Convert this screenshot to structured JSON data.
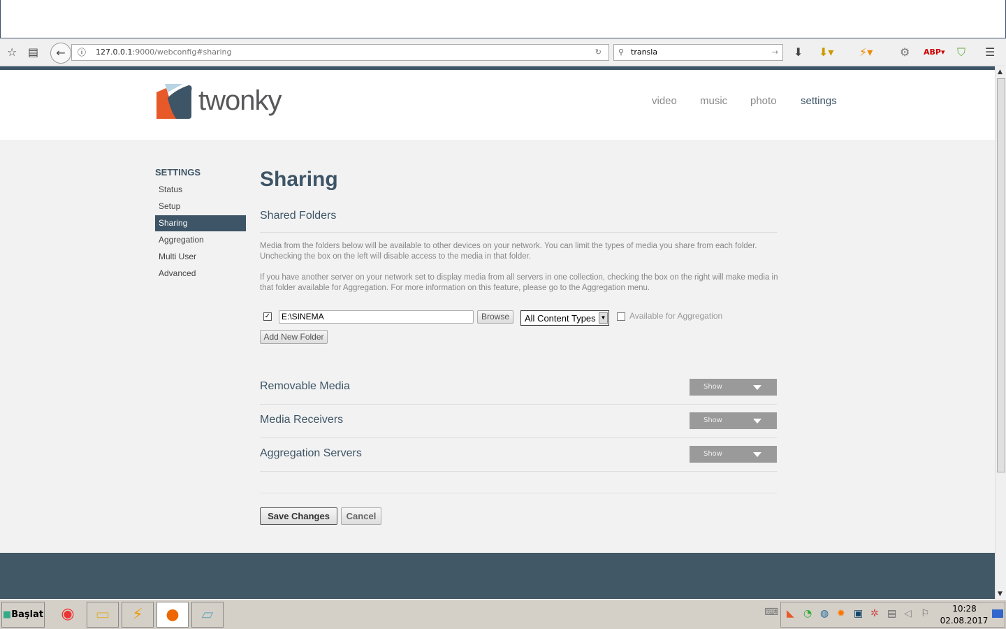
{
  "browser": {
    "url_host": "127.0.0.1",
    "url_rest": ":9000/webconfig#sharing",
    "search_value": "transla"
  },
  "header": {
    "logo": "twonky",
    "nav": [
      "video",
      "music",
      "photo",
      "settings"
    ]
  },
  "sidebar": {
    "heading": "SETTINGS",
    "items": [
      "Status",
      "Setup",
      "Sharing",
      "Aggregation",
      "Multi User",
      "Advanced"
    ],
    "active": "Sharing"
  },
  "main": {
    "title": "Sharing",
    "shared_folders": "Shared Folders",
    "para1": "Media from the folders below will be available to other devices on your network. You can limit the types of media you share from each folder. Unchecking the box on the left will disable access to the media in that folder.",
    "para2": "If you have another server on your network set to display media from all servers in one collection, checking the box on the right will make media in that folder available for Aggregation. For more information on this feature, please go to the Aggregation menu.",
    "folder_path": "E:\\SINEMA",
    "folder_enabled": true,
    "browse": "Browse",
    "content_type": "All Content Types",
    "aggregation_label": "Available for Aggregation",
    "aggregation_checked": false,
    "add_folder": "Add New Folder",
    "sections": [
      {
        "title": "Removable Media",
        "button": "Show"
      },
      {
        "title": "Media Receivers",
        "button": "Show"
      },
      {
        "title": "Aggregation Servers",
        "button": "Show"
      }
    ],
    "save": "Save Changes",
    "cancel": "Cancel"
  },
  "taskbar": {
    "start": "Başlat",
    "time": "10:28",
    "date": "02.08.2017"
  },
  "colors": {
    "accent": "#3d5566",
    "logo_orange": "#e8592a"
  }
}
